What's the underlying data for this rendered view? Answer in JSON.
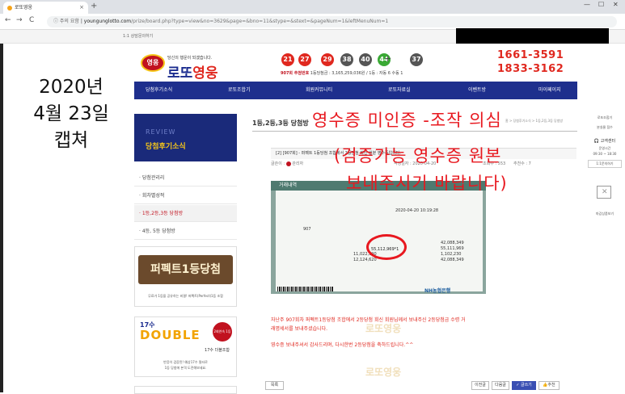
{
  "browser": {
    "tab_title": "로또영웅",
    "tab_close": "×",
    "new_tab": "+",
    "win_min": "—",
    "win_max": "☐",
    "win_close": "✕",
    "nav_back": "←",
    "nav_forward": "→",
    "nav_reload": "C",
    "security_label": "ⓘ 주의 요함",
    "url_host": "youngunglotto.com",
    "url_path": "/prize/board.php?type=view&no=3629&page=&bno=11&stype=&stext=&pageNum=1&leftMenuNum=1"
  },
  "subbar": {
    "text": "1:1 상담문의하기"
  },
  "caption": {
    "line1": "2020년",
    "line2": "4월 23일",
    "line3": "캡쳐"
  },
  "header": {
    "logo_badge": "영웅",
    "logo_sub": "당신의 행운이 되겠습니다.",
    "logo_main_a": "로또",
    "logo_main_b": "영웅",
    "balls": [
      {
        "num": "21",
        "color": "#e0281f"
      },
      {
        "num": "27",
        "color": "#e0281f"
      },
      {
        "num": "29",
        "color": "#e0281f"
      },
      {
        "num": "38",
        "color": "#555555"
      },
      {
        "num": "40",
        "color": "#555555"
      },
      {
        "num": "44",
        "color": "#3aa935"
      },
      {
        "num": "37",
        "color": "#555555"
      }
    ],
    "plus": "+",
    "draw_no": "907회 추첨번호",
    "draw_detail": "1등당첨금 : 3,165,259,036원 / 1등 : 자동 6 수동 1",
    "phone1": "1661-3591",
    "phone2": "1833-3162"
  },
  "nav": {
    "items": [
      "당첨후기소식",
      "로또조합기",
      "회원커뮤니티",
      "로또자료실",
      "이벤트방",
      "마이페이지"
    ]
  },
  "sidebar": {
    "banner_sub": "REVIEW",
    "banner_title": "당첨후기소식",
    "items": [
      "당첨관리리",
      "회차별성적",
      "1등,2등,3등 당첨방",
      "4등, 5등 당첨방"
    ],
    "ad1_text": "퍼펙트1등당첨",
    "ad1_note": "무료가 1등을 공유하는 비결! 퍼펙트(Perfect)1등 조합",
    "ad2_num": "17수",
    "ad2_main": "DOUBLE",
    "ad2_badge": "2회연속 1등당첨",
    "ad2_caption": "17수 더블조합",
    "ad2_line1": "반응이 검증된! 예상17수 필터로",
    "ad2_line2": "1등 당첨에 본격 도전해보세요."
  },
  "content": {
    "title": "1등,2등,3등 당첨방",
    "breadcrumb": "홈 > 당첨후기소식 > 1등,2등,3등 당첨방",
    "post_title": "[2] [907회] - 퍼펙트 1등당첨 조합에서 2등당첨 회선 원분 영수증입니다.",
    "author_label": "글쓴이 :",
    "author": "관리자",
    "date": "작성일자 : 2020-04-20",
    "views": "조회수 : 553",
    "recommend": "추천수 : 7",
    "receipt_head": "거래내역",
    "receipt_amounts": [
      "42,088,349",
      "55,111,969",
      "1,102,230",
      "42,088,349"
    ],
    "receipt_second_prize": "55,112,969*1",
    "receipt_tax": [
      "11,022,390",
      "12,124,620"
    ],
    "receipt_date": "2020-04-20 10:19:28",
    "receipt_draw": "907",
    "receipt_bank": "NH농협은행",
    "body_line1": "자난주 907회차 퍼펙트1등당첨 조합에서 2등당첨 회신 회원님께서 보내주신 2등당첨금 수령 거",
    "body_line2": "래명세서를 보내주셨습니다.",
    "body_line3": "영수증 보내주셔서 감사드리며, 다시한번 2등당첨을 축하드립니다.^^",
    "watermark": "로또영웅",
    "btn_list": "목록",
    "btn_prev": "이전글",
    "btn_next": "다음글",
    "btn_write": "글쓰기",
    "btn_recommend": "추천"
  },
  "right_rail": {
    "item1": "로또조합기",
    "item2": "분실물 접수",
    "service_title": "고객센터",
    "service_hours_label": "운영시간",
    "service_hours": "09:30 ~ 18:30",
    "chat_button": "1:1문의하기",
    "bag_label": "마감상품보기"
  },
  "overlay": {
    "line1": "영수증 미인증 -조작 의심",
    "line2": "(검증가능 영수증 원본",
    "line3": "보내주시기 바랍니다)"
  }
}
